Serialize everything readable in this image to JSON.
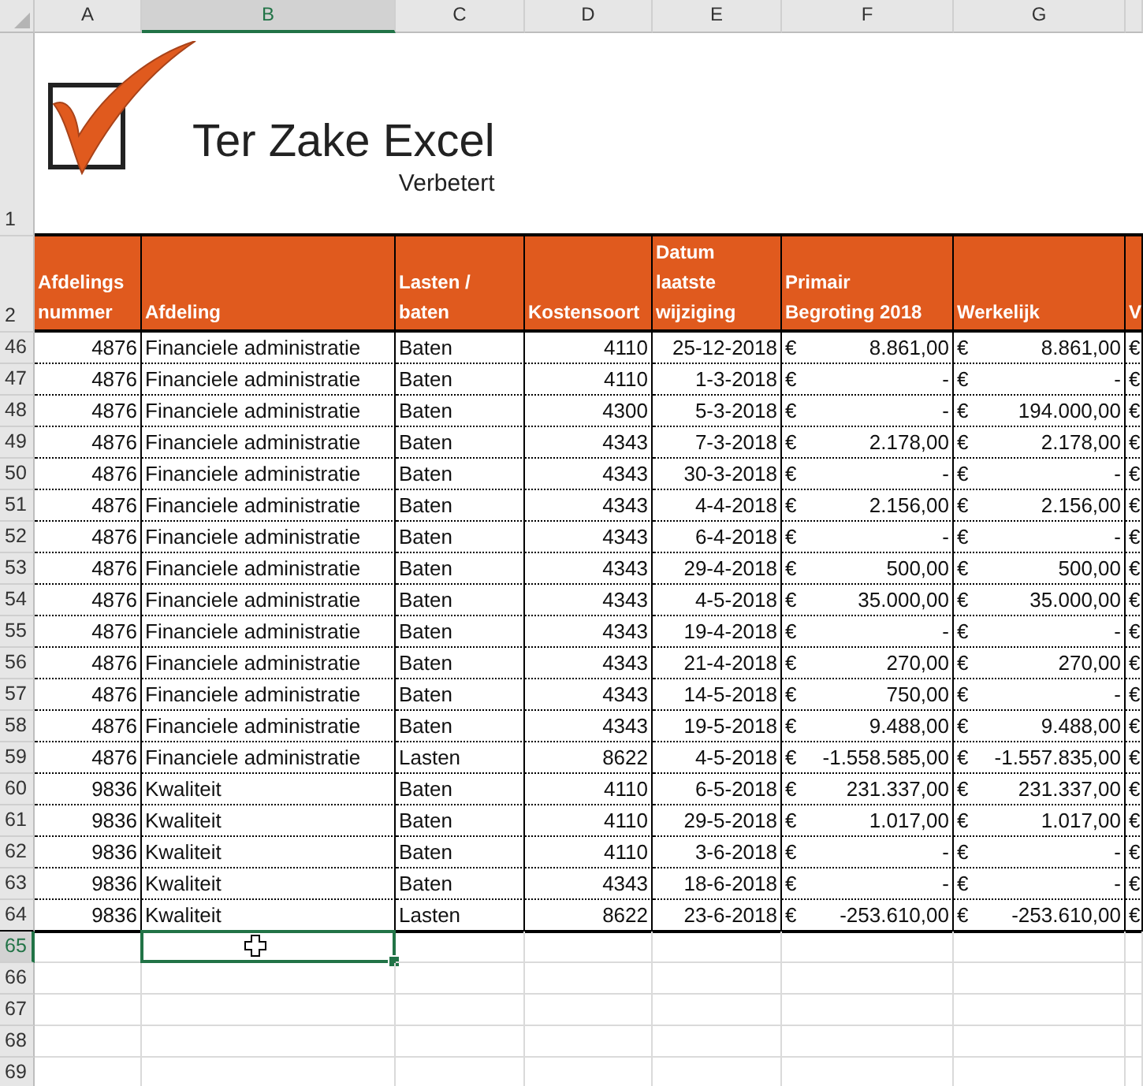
{
  "column_headers": [
    {
      "label": "A",
      "selected": false
    },
    {
      "label": "B",
      "selected": true
    },
    {
      "label": "C",
      "selected": false
    },
    {
      "label": "D",
      "selected": false
    },
    {
      "label": "E",
      "selected": false
    },
    {
      "label": "F",
      "selected": false
    },
    {
      "label": "G",
      "selected": false
    }
  ],
  "logo": {
    "row": "1",
    "title": "Ter Zake Excel",
    "subtitle": "Verbetert"
  },
  "table": {
    "header_row": "2",
    "columns": [
      {
        "label": "Afdelings\nnummer",
        "kind": "number"
      },
      {
        "label": "Afdeling",
        "kind": "text"
      },
      {
        "label": "Lasten /\nbaten",
        "kind": "text"
      },
      {
        "label": "Kostensoort",
        "kind": "number"
      },
      {
        "label": "Datum\nlaatste\nwijziging",
        "kind": "number"
      },
      {
        "label": "Primair\nBegroting 2018",
        "kind": "money"
      },
      {
        "label": "Werkelijk",
        "kind": "money"
      },
      {
        "label": "V",
        "kind": "money"
      }
    ],
    "rows": [
      {
        "row": "46",
        "cells": [
          "4876",
          "Financiele administratie",
          "Baten",
          "4110",
          "25-12-2018",
          [
            "€",
            "8.861,00"
          ],
          [
            "€",
            "8.861,00"
          ],
          [
            "€"
          ]
        ]
      },
      {
        "row": "47",
        "cells": [
          "4876",
          "Financiele administratie",
          "Baten",
          "4110",
          "1-3-2018",
          [
            "€",
            "-"
          ],
          [
            "€",
            "-"
          ],
          [
            "€"
          ]
        ]
      },
      {
        "row": "48",
        "cells": [
          "4876",
          "Financiele administratie",
          "Baten",
          "4300",
          "5-3-2018",
          [
            "€",
            "-"
          ],
          [
            "€",
            "194.000,00"
          ],
          [
            "€"
          ]
        ]
      },
      {
        "row": "49",
        "cells": [
          "4876",
          "Financiele administratie",
          "Baten",
          "4343",
          "7-3-2018",
          [
            "€",
            "2.178,00"
          ],
          [
            "€",
            "2.178,00"
          ],
          [
            "€"
          ]
        ]
      },
      {
        "row": "50",
        "cells": [
          "4876",
          "Financiele administratie",
          "Baten",
          "4343",
          "30-3-2018",
          [
            "€",
            "-"
          ],
          [
            "€",
            "-"
          ],
          [
            "€"
          ]
        ]
      },
      {
        "row": "51",
        "cells": [
          "4876",
          "Financiele administratie",
          "Baten",
          "4343",
          "4-4-2018",
          [
            "€",
            "2.156,00"
          ],
          [
            "€",
            "2.156,00"
          ],
          [
            "€"
          ]
        ]
      },
      {
        "row": "52",
        "cells": [
          "4876",
          "Financiele administratie",
          "Baten",
          "4343",
          "6-4-2018",
          [
            "€",
            "-"
          ],
          [
            "€",
            "-"
          ],
          [
            "€"
          ]
        ]
      },
      {
        "row": "53",
        "cells": [
          "4876",
          "Financiele administratie",
          "Baten",
          "4343",
          "29-4-2018",
          [
            "€",
            "500,00"
          ],
          [
            "€",
            "500,00"
          ],
          [
            "€"
          ]
        ]
      },
      {
        "row": "54",
        "cells": [
          "4876",
          "Financiele administratie",
          "Baten",
          "4343",
          "4-5-2018",
          [
            "€",
            "35.000,00"
          ],
          [
            "€",
            "35.000,00"
          ],
          [
            "€"
          ]
        ]
      },
      {
        "row": "55",
        "cells": [
          "4876",
          "Financiele administratie",
          "Baten",
          "4343",
          "19-4-2018",
          [
            "€",
            "-"
          ],
          [
            "€",
            "-"
          ],
          [
            "€"
          ]
        ]
      },
      {
        "row": "56",
        "cells": [
          "4876",
          "Financiele administratie",
          "Baten",
          "4343",
          "21-4-2018",
          [
            "€",
            "270,00"
          ],
          [
            "€",
            "270,00"
          ],
          [
            "€"
          ]
        ]
      },
      {
        "row": "57",
        "cells": [
          "4876",
          "Financiele administratie",
          "Baten",
          "4343",
          "14-5-2018",
          [
            "€",
            "750,00"
          ],
          [
            "€",
            "-"
          ],
          [
            "€"
          ]
        ]
      },
      {
        "row": "58",
        "cells": [
          "4876",
          "Financiele administratie",
          "Baten",
          "4343",
          "19-5-2018",
          [
            "€",
            "9.488,00"
          ],
          [
            "€",
            "9.488,00"
          ],
          [
            "€"
          ]
        ]
      },
      {
        "row": "59",
        "cells": [
          "4876",
          "Financiele administratie",
          "Lasten",
          "8622",
          "4-5-2018",
          [
            "€",
            "-1.558.585,00"
          ],
          [
            "€",
            "-1.557.835,00"
          ],
          [
            "€"
          ]
        ]
      },
      {
        "row": "60",
        "cells": [
          "9836",
          "Kwaliteit",
          "Baten",
          "4110",
          "6-5-2018",
          [
            "€",
            "231.337,00"
          ],
          [
            "€",
            "231.337,00"
          ],
          [
            "€"
          ]
        ]
      },
      {
        "row": "61",
        "cells": [
          "9836",
          "Kwaliteit",
          "Baten",
          "4110",
          "29-5-2018",
          [
            "€",
            "1.017,00"
          ],
          [
            "€",
            "1.017,00"
          ],
          [
            "€"
          ]
        ]
      },
      {
        "row": "62",
        "cells": [
          "9836",
          "Kwaliteit",
          "Baten",
          "4110",
          "3-6-2018",
          [
            "€",
            "-"
          ],
          [
            "€",
            "-"
          ],
          [
            "€"
          ]
        ]
      },
      {
        "row": "63",
        "cells": [
          "9836",
          "Kwaliteit",
          "Baten",
          "4343",
          "18-6-2018",
          [
            "€",
            "-"
          ],
          [
            "€",
            "-"
          ],
          [
            "€"
          ]
        ]
      },
      {
        "row": "64",
        "cells": [
          "9836",
          "Kwaliteit",
          "Lasten",
          "8622",
          "23-6-2018",
          [
            "€",
            "-253.610,00"
          ],
          [
            "€",
            "-253.610,00"
          ],
          [
            "€"
          ]
        ]
      }
    ]
  },
  "empty_rows": [
    {
      "row": "65",
      "selected": true
    },
    {
      "row": "66",
      "selected": false
    },
    {
      "row": "67",
      "selected": false
    },
    {
      "row": "68",
      "selected": false
    },
    {
      "row": "69",
      "selected": false
    }
  ]
}
